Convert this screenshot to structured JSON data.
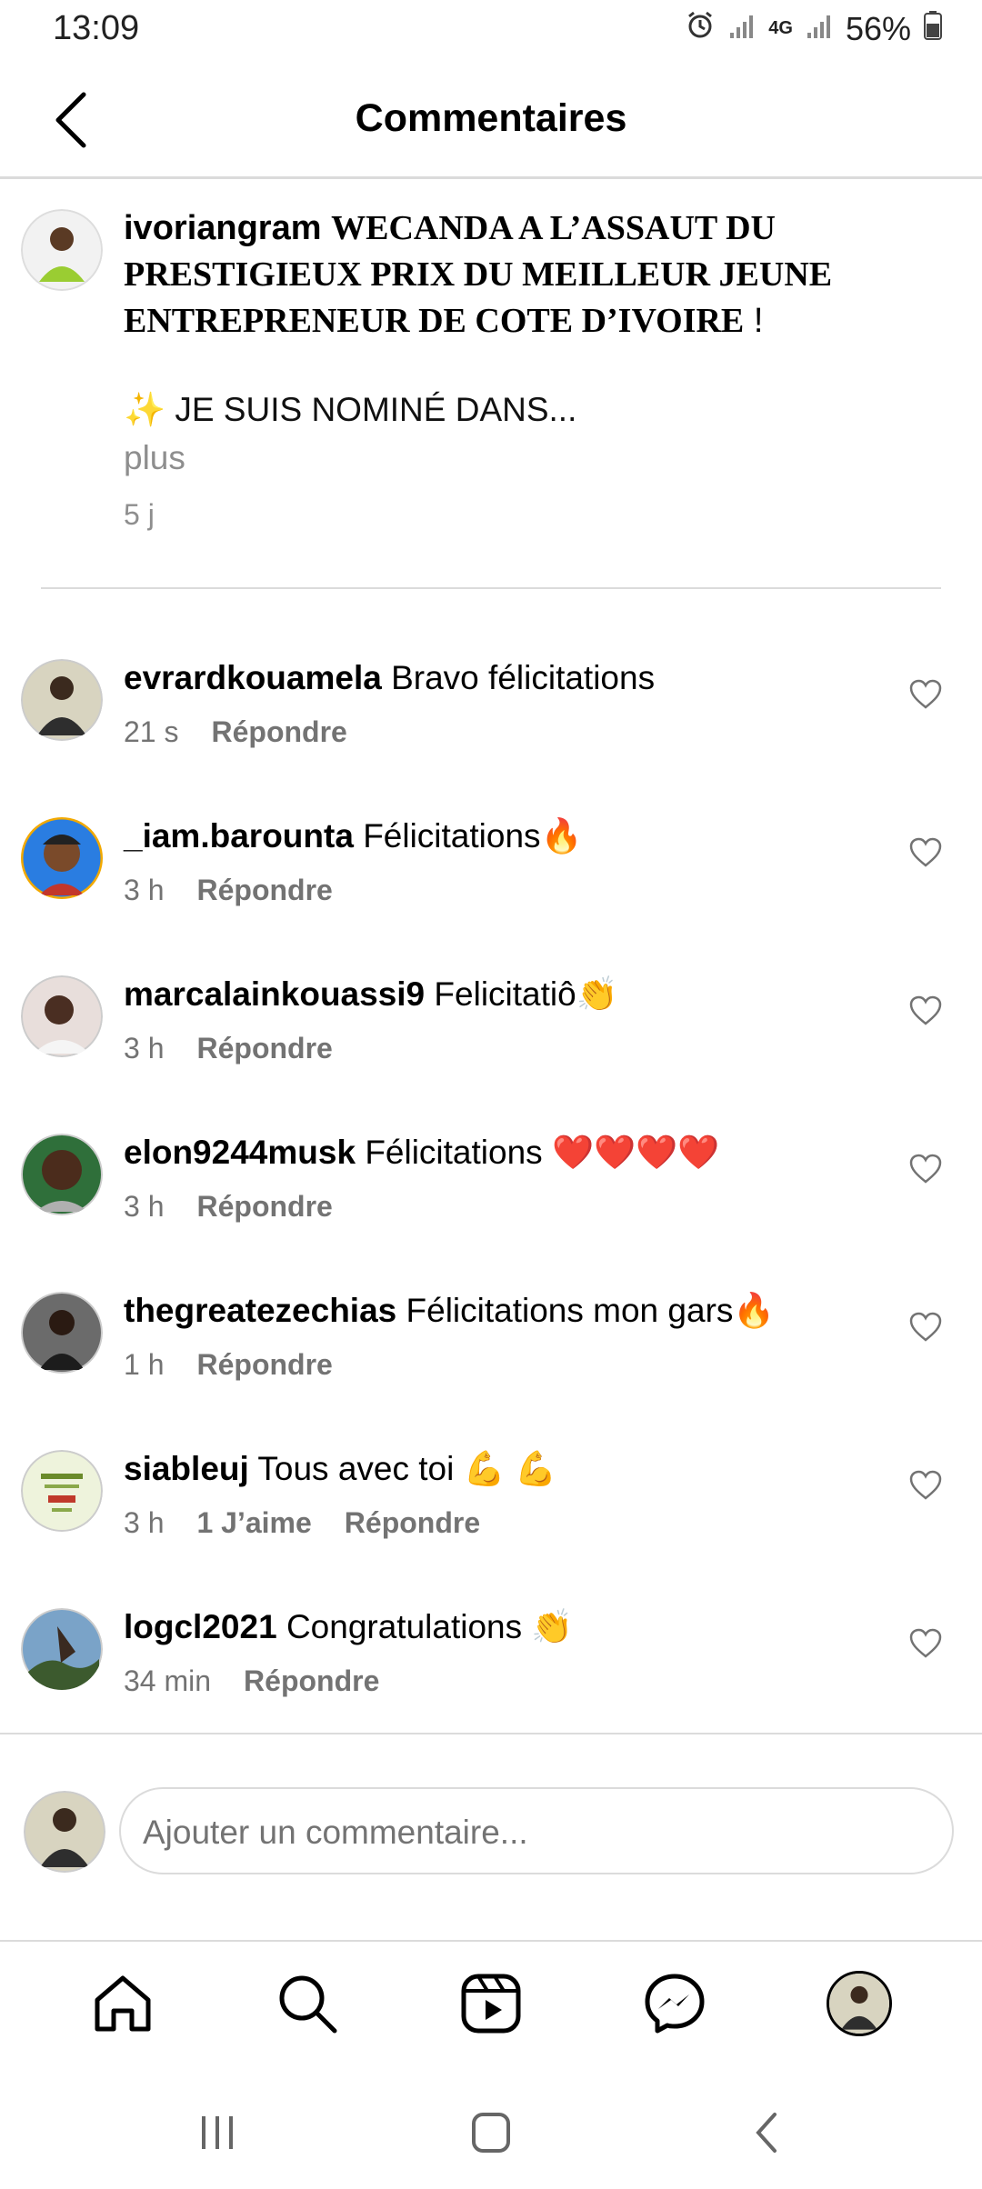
{
  "status": {
    "time": "13:09",
    "network": "4G",
    "battery": "56%"
  },
  "header": {
    "title": "Commentaires"
  },
  "caption": {
    "username": "ivoriangram",
    "title": "WECANDA A L’ASSAUT DU PRESTIGIEUX PRIX DU MEILLEUR JEUNE ENTREPRENEUR DE COTE D’IVOIRE",
    "title_end": " !",
    "body": "✨ JE SUIS NOMINÉ DANS...",
    "more": "plus",
    "time": "5 j"
  },
  "comments": [
    {
      "username": "evrardkouamela",
      "text": "Bravo félicitations",
      "time": "21 s",
      "likes": "",
      "reply": "Répondre"
    },
    {
      "username": "_iam.barounta",
      "text": "Félicitations🔥",
      "time": "3 h",
      "likes": "",
      "reply": "Répondre"
    },
    {
      "username": "marcalainkouassi9",
      "text": "Felicitatiô👏",
      "time": "3 h",
      "likes": "",
      "reply": "Répondre"
    },
    {
      "username": "elon9244musk",
      "text": "Félicitations ❤️❤️❤️❤️",
      "time": "3 h",
      "likes": "",
      "reply": "Répondre"
    },
    {
      "username": "thegreatezechias",
      "text": "Félicitations mon gars🔥",
      "time": "1 h",
      "likes": "",
      "reply": "Répondre"
    },
    {
      "username": "siableuj",
      "text": "Tous avec toi 💪 💪",
      "time": "3 h",
      "likes": "1 J’aime",
      "reply": "Répondre"
    },
    {
      "username": "logcl2021",
      "text": "Congratulations 👏",
      "time": "34 min",
      "likes": "",
      "reply": "Répondre"
    }
  ],
  "input": {
    "placeholder": "Ajouter un commentaire..."
  },
  "nav": [
    "home-icon",
    "search-icon",
    "reels-icon",
    "messenger-icon",
    "profile-avatar"
  ],
  "colors": {
    "secondary_text": "#737373",
    "divider": "#dbdbdb"
  }
}
